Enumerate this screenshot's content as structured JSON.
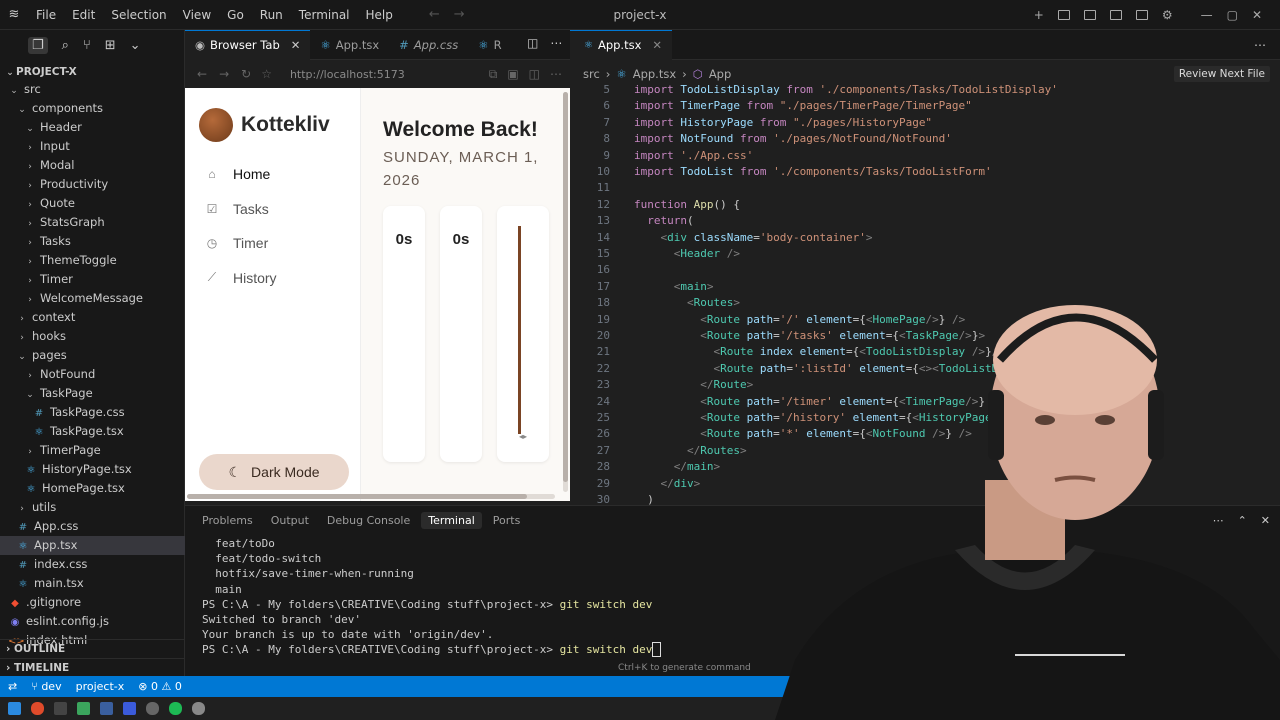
{
  "titlebar": {
    "menu": [
      "File",
      "Edit",
      "Selection",
      "View",
      "Go",
      "Run",
      "Terminal",
      "Help"
    ],
    "title": "project-x"
  },
  "explorer": {
    "root": "PROJECT-X",
    "tree": [
      {
        "label": "src",
        "depth": 1,
        "type": "folder-open"
      },
      {
        "label": "components",
        "depth": 2,
        "type": "folder-open"
      },
      {
        "label": "Header",
        "depth": 3,
        "type": "folder-open"
      },
      {
        "label": "Input",
        "depth": 3,
        "type": "folder"
      },
      {
        "label": "Modal",
        "depth": 3,
        "type": "folder"
      },
      {
        "label": "Productivity",
        "depth": 3,
        "type": "folder"
      },
      {
        "label": "Quote",
        "depth": 3,
        "type": "folder"
      },
      {
        "label": "StatsGraph",
        "depth": 3,
        "type": "folder"
      },
      {
        "label": "Tasks",
        "depth": 3,
        "type": "folder"
      },
      {
        "label": "ThemeToggle",
        "depth": 3,
        "type": "folder"
      },
      {
        "label": "Timer",
        "depth": 3,
        "type": "folder"
      },
      {
        "label": "WelcomeMessage",
        "depth": 3,
        "type": "folder"
      },
      {
        "label": "context",
        "depth": 2,
        "type": "folder"
      },
      {
        "label": "hooks",
        "depth": 2,
        "type": "folder"
      },
      {
        "label": "pages",
        "depth": 2,
        "type": "folder-open"
      },
      {
        "label": "NotFound",
        "depth": 3,
        "type": "folder"
      },
      {
        "label": "TaskPage",
        "depth": 3,
        "type": "folder-open"
      },
      {
        "label": "TaskPage.css",
        "depth": 4,
        "type": "css"
      },
      {
        "label": "TaskPage.tsx",
        "depth": 4,
        "type": "tsx"
      },
      {
        "label": "TimerPage",
        "depth": 3,
        "type": "folder"
      },
      {
        "label": "HistoryPage.tsx",
        "depth": 3,
        "type": "tsx"
      },
      {
        "label": "HomePage.tsx",
        "depth": 3,
        "type": "tsx"
      },
      {
        "label": "utils",
        "depth": 2,
        "type": "folder"
      },
      {
        "label": "App.css",
        "depth": 2,
        "type": "css"
      },
      {
        "label": "App.tsx",
        "depth": 2,
        "type": "tsx",
        "selected": true
      },
      {
        "label": "index.css",
        "depth": 2,
        "type": "css"
      },
      {
        "label": "main.tsx",
        "depth": 2,
        "type": "tsx"
      },
      {
        "label": ".gitignore",
        "depth": 1,
        "type": "git"
      },
      {
        "label": "eslint.config.js",
        "depth": 1,
        "type": "eslint"
      },
      {
        "label": "index.html",
        "depth": 1,
        "type": "html"
      }
    ],
    "outline": "OUTLINE",
    "timeline": "TIMELINE"
  },
  "browser": {
    "tabs": [
      {
        "label": "Browser Tab",
        "active": true
      },
      {
        "label": "App.tsx",
        "active": false
      },
      {
        "label": "App.css",
        "active": false
      },
      {
        "label": "R",
        "active": false
      }
    ],
    "url": "http://localhost:5173"
  },
  "app": {
    "brand": "Kottekliv",
    "nav": [
      {
        "label": "Home",
        "icon": "home-icon",
        "current": true
      },
      {
        "label": "Tasks",
        "icon": "checkbox-icon",
        "current": false
      },
      {
        "label": "Timer",
        "icon": "clock-icon",
        "current": false
      },
      {
        "label": "History",
        "icon": "chart-icon",
        "current": false
      }
    ],
    "welcome": "Welcome Back!",
    "date": "SUNDAY, MARCH 1, 2026",
    "timers": [
      "0s",
      "0s"
    ],
    "darkmode": "Dark Mode"
  },
  "editor": {
    "tab": "App.tsx",
    "breadcrumb": [
      "src",
      "App.tsx",
      "App"
    ],
    "review": "Review Next File"
  },
  "panel": {
    "tabs": [
      "Problems",
      "Output",
      "Debug Console",
      "Terminal",
      "Ports"
    ],
    "active": "Terminal",
    "lines": [
      {
        "text": "  feat/toDo"
      },
      {
        "text": "  feat/todo-switch"
      },
      {
        "text": "  hotfix/save-timer-when-running"
      },
      {
        "text": "  main"
      },
      {
        "prompt": "PS C:\\A - My folders\\CREATIVE\\Coding stuff\\project-x> ",
        "cmd": "git switch dev"
      },
      {
        "text": "Switched to branch 'dev'"
      },
      {
        "text": "Your branch is up to date with 'origin/dev'."
      },
      {
        "prompt": "PS C:\\A - My folders\\CREATIVE\\Coding stuff\\project-x> ",
        "cmd": "git switch dev"
      }
    ],
    "hint": "Ctrl+K to generate command"
  },
  "status": {
    "branch": "dev",
    "project": "project-x",
    "problems": "⊗ 0 ⚠ 0"
  }
}
